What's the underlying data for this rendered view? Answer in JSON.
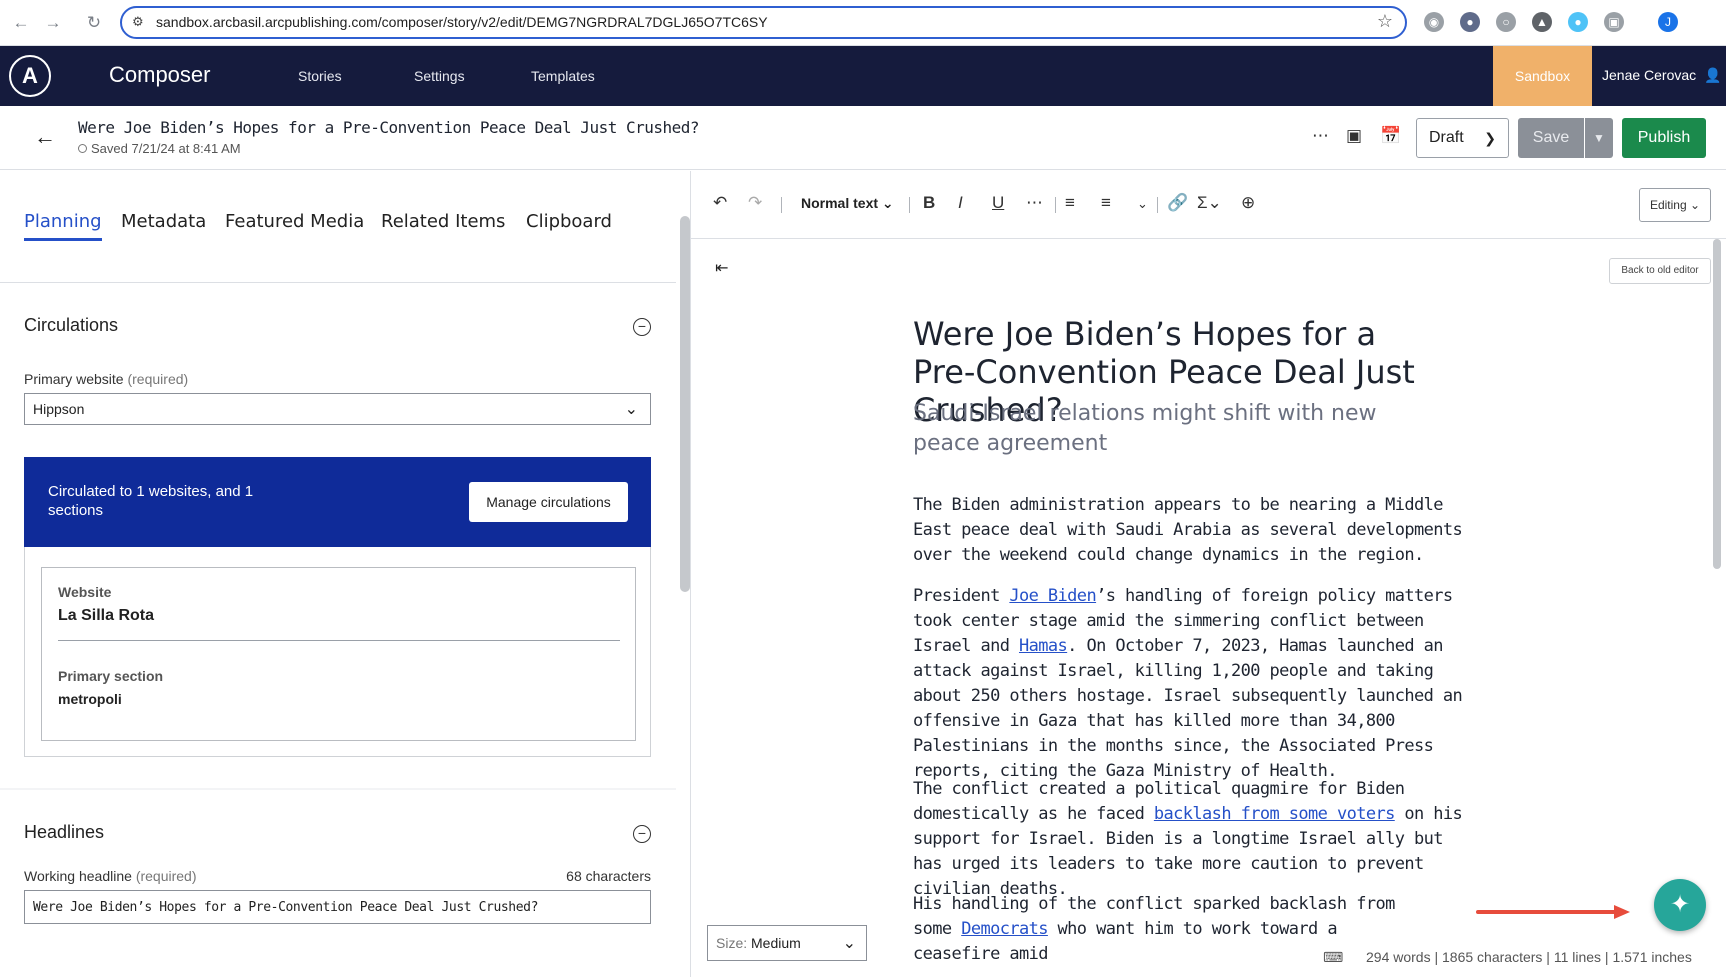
{
  "browser": {
    "url": "sandbox.arcbasil.arcpublishing.com/composer/story/v2/edit/DEMG7NGRDRAL7DGLJ65O7TC6SY",
    "profile_initial": "J"
  },
  "header": {
    "logo": "A",
    "app_title": "Composer",
    "nav": [
      "Stories",
      "Settings",
      "Templates"
    ],
    "environment": "Sandbox",
    "user_name": "Jenae Cerovac",
    "colors": {
      "header_bg": "#151b3d",
      "sandbox": "#f0b16a"
    }
  },
  "story": {
    "title": "Were Joe Biden’s Hopes for a Pre-Convention Peace Deal Just Crushed?",
    "saved": "Saved 7/21/24 at 8:41 AM",
    "status_select": "Draft",
    "save_label": "Save",
    "publish_label": "Publish",
    "colors": {
      "publish": "#1b8a4c",
      "save": "#8b9098"
    }
  },
  "left_panel": {
    "tabs": [
      "Planning",
      "Metadata",
      "Featured Media",
      "Related Items",
      "Clipboard"
    ],
    "active_tab": "Planning",
    "circulations": {
      "title": "Circulations",
      "primary_website_label": "Primary website",
      "required": "(required)",
      "primary_website_value": "Hippson",
      "banner_text": "Circulated to 1 websites, and 1 sections",
      "manage_label": "Manage circulations",
      "website_label": "Website",
      "website_value": "La Silla Rota",
      "section_label": "Primary section",
      "section_value": "metropoli",
      "banner_color": "#0f2b99"
    },
    "headlines": {
      "title": "Headlines",
      "working_label": "Working headline",
      "required": "(required)",
      "char_count": "68 characters",
      "working_value": "Were Joe Biden’s Hopes for a Pre-Convention Peace Deal Just Crushed?"
    }
  },
  "editor": {
    "text_style": "Normal text",
    "mode": "Editing",
    "back_old": "Back to old editor",
    "headline": "Were Joe Biden’s Hopes for a Pre-Convention Peace Deal Just Crushed?",
    "subheadline": "Saudi-Israel relations might shift with new peace agreement",
    "paragraphs": {
      "p1": "The Biden administration appears to be nearing a Middle East peace deal with Saudi Arabia as several developments over the weekend could change dynamics in the region.",
      "p2_a": "President ",
      "p2_link1": "Joe Biden",
      "p2_b": "’s handling of foreign policy matters took center stage amid the simmering conflict between Israel and ",
      "p2_link2": "Hamas",
      "p2_c": ". On October 7, 2023, Hamas launched an attack against Israel, killing 1,200 people and taking about 250 others hostage. Israel subsequently launched an offensive in Gaza that has killed more than 34,800 Palestinians in the months since, the Associated Press reports, citing the Gaza Ministry of Health.",
      "p3_a": "The conflict created a political quagmire for Biden domestically as he faced ",
      "p3_link": "backlash from some voters",
      "p3_b": " on his support for Israel. Biden is a longtime Israel ally but has urged its leaders to take more caution to prevent civilian deaths.",
      "p4_a": "His handling of the conflict sparked backlash from some ",
      "p4_link": "Democrats",
      "p4_b": " who want him to work toward a ceasefire amid"
    },
    "size_label": "Size:",
    "size_value": "Medium",
    "stats": "294 words | 1865 characters | 11 lines | 1.571 inches",
    "colors": {
      "link": "#2550c8",
      "fab": "#26a69a",
      "arrow": "#e74c3c"
    }
  }
}
